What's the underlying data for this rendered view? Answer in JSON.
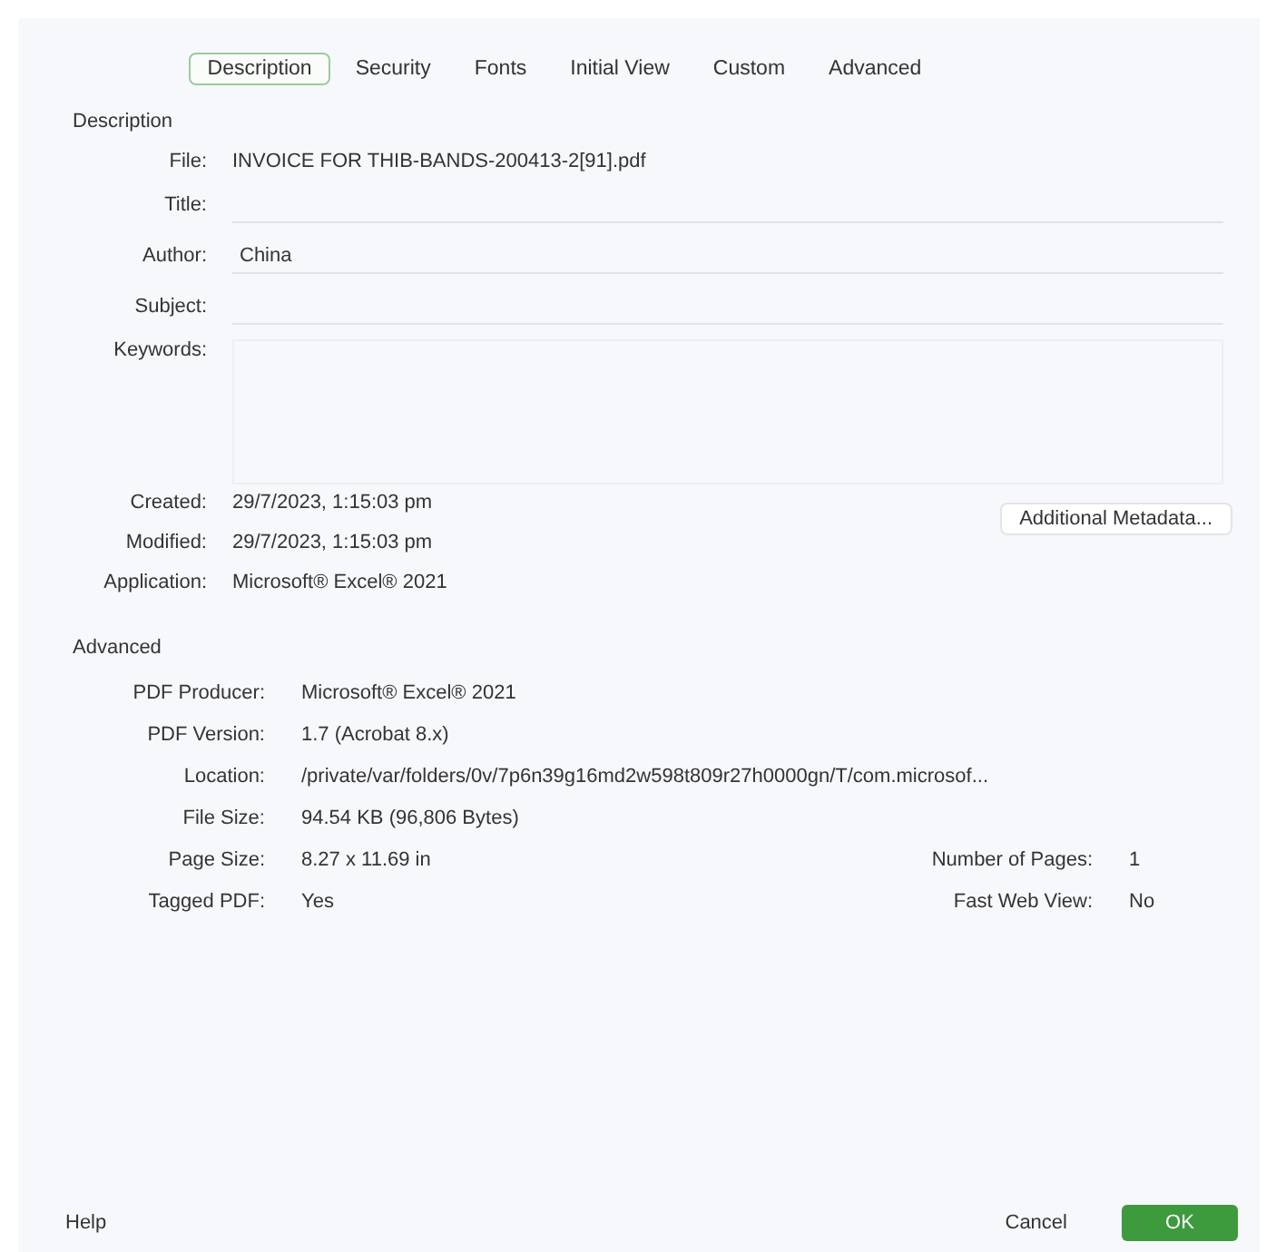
{
  "tabs": [
    {
      "label": "Description",
      "selected": true
    },
    {
      "label": "Security",
      "selected": false
    },
    {
      "label": "Fonts",
      "selected": false
    },
    {
      "label": "Initial View",
      "selected": false
    },
    {
      "label": "Custom",
      "selected": false
    },
    {
      "label": "Advanced",
      "selected": false
    }
  ],
  "description": {
    "heading": "Description",
    "file": {
      "label": "File:",
      "value": "INVOICE FOR THIB-BANDS-200413-2[91].pdf"
    },
    "fields": [
      {
        "label": "Title:",
        "kind": "line"
      },
      {
        "label": "Author:",
        "value": "China",
        "kind": "line"
      },
      {
        "label": "Subject:",
        "kind": "line"
      },
      {
        "label": "Keywords:",
        "kind": "area"
      }
    ],
    "dates": [
      {
        "label": "Created:",
        "value": "29/7/2023, 1:15:03 pm"
      },
      {
        "label": "Modified:",
        "value": "29/7/2023, 1:15:03 pm"
      },
      {
        "label": "Application:",
        "value": "Microsoft® Excel® 2021"
      }
    ],
    "metadata_button": "Additional Metadata..."
  },
  "advanced": {
    "heading": "Advanced",
    "rows": [
      {
        "label": "PDF Producer:",
        "value": "Microsoft® Excel® 2021"
      },
      {
        "label": "PDF Version:",
        "value": "1.7 (Acrobat 8.x)"
      },
      {
        "label": "Location:",
        "value": "/private/var/folders/0v/7p6n39g16md2w598t809r27h0000gn/T/com.microsof..."
      },
      {
        "label": "File Size:",
        "value": "94.54 KB (96,806 Bytes)"
      },
      {
        "label": "Page Size:",
        "value": "8.27 x 11.69 in",
        "side_label": "Number of Pages:",
        "side_value": "1"
      },
      {
        "label": "Tagged PDF:",
        "value": "Yes",
        "side_label": "Fast Web View:",
        "side_value": "No"
      }
    ]
  },
  "footer": {
    "help": "Help",
    "cancel": "Cancel",
    "ok": "OK"
  }
}
